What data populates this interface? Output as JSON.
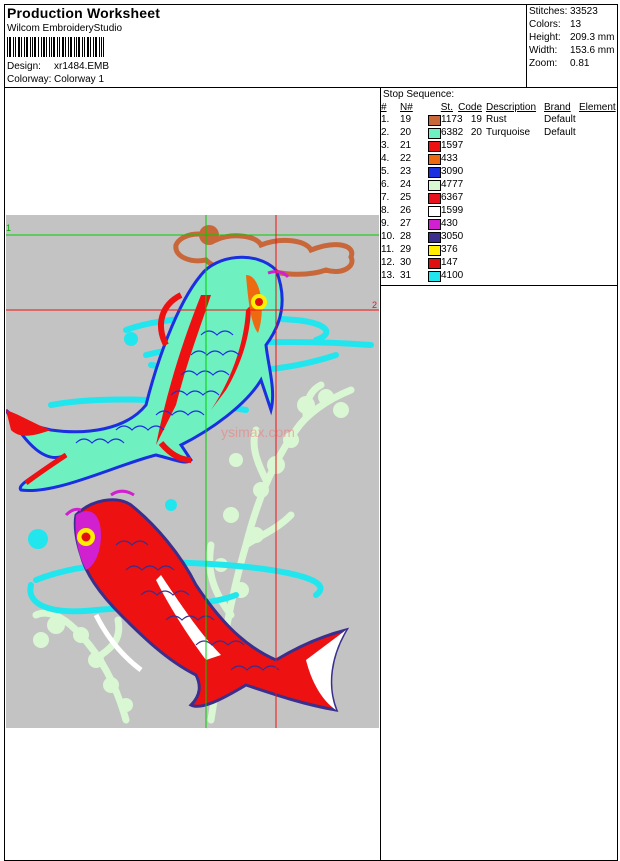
{
  "header": {
    "title": "Production Worksheet",
    "subtitle": "Wilcom EmbroideryStudio",
    "design_label": "Design:",
    "design_value": "xr1484.EMB",
    "colorway_label": "Colorway:",
    "colorway_value": "Colorway 1"
  },
  "stats": [
    {
      "label": "Stitches:",
      "value": "33523"
    },
    {
      "label": "Colors:",
      "value": "13"
    },
    {
      "label": "Height:",
      "value": "209.3 mm"
    },
    {
      "label": "Width:",
      "value": "153.6 mm"
    },
    {
      "label": "Zoom:",
      "value": "0.81"
    }
  ],
  "stop_sequence": {
    "title": "Stop Sequence:",
    "headers": [
      "#",
      "N#",
      "St.",
      "Code",
      "Description",
      "Brand",
      "Element"
    ],
    "rows": [
      {
        "n": "1.",
        "needle": "19",
        "color": "#c8683a",
        "stitches": "1173",
        "code": "19",
        "description": "Rust",
        "brand": "Default"
      },
      {
        "n": "2.",
        "needle": "20",
        "color": "#6ff0c0",
        "stitches": "6382",
        "code": "20",
        "description": "Turquoise",
        "brand": "Default"
      },
      {
        "n": "3.",
        "needle": "21",
        "color": "#ee1111",
        "stitches": "1597",
        "code": "",
        "description": "",
        "brand": ""
      },
      {
        "n": "4.",
        "needle": "22",
        "color": "#ee6a10",
        "stitches": "433",
        "code": "",
        "description": "",
        "brand": ""
      },
      {
        "n": "5.",
        "needle": "23",
        "color": "#1a2fe0",
        "stitches": "3090",
        "code": "",
        "description": "",
        "brand": ""
      },
      {
        "n": "6.",
        "needle": "24",
        "color": "#d9f7d3",
        "stitches": "4777",
        "code": "",
        "description": "",
        "brand": ""
      },
      {
        "n": "7.",
        "needle": "25",
        "color": "#e8121c",
        "stitches": "6367",
        "code": "",
        "description": "",
        "brand": ""
      },
      {
        "n": "8.",
        "needle": "26",
        "color": "#ffffff",
        "stitches": "1599",
        "code": "",
        "description": "",
        "brand": ""
      },
      {
        "n": "9.",
        "needle": "27",
        "color": "#d020d0",
        "stitches": "430",
        "code": "",
        "description": "",
        "brand": ""
      },
      {
        "n": "10.",
        "needle": "28",
        "color": "#3a2f8c",
        "stitches": "3050",
        "code": "",
        "description": "",
        "brand": ""
      },
      {
        "n": "11.",
        "needle": "29",
        "color": "#ffee00",
        "stitches": "376",
        "code": "",
        "description": "",
        "brand": ""
      },
      {
        "n": "12.",
        "needle": "30",
        "color": "#e01010",
        "stitches": "147",
        "code": "",
        "description": "",
        "brand": ""
      },
      {
        "n": "13.",
        "needle": "31",
        "color": "#22e6ee",
        "stitches": "4100",
        "code": "",
        "description": "",
        "brand": ""
      }
    ]
  },
  "design": {
    "marker_1": "1",
    "marker_2": "2",
    "watermark": "ysimax.com"
  }
}
